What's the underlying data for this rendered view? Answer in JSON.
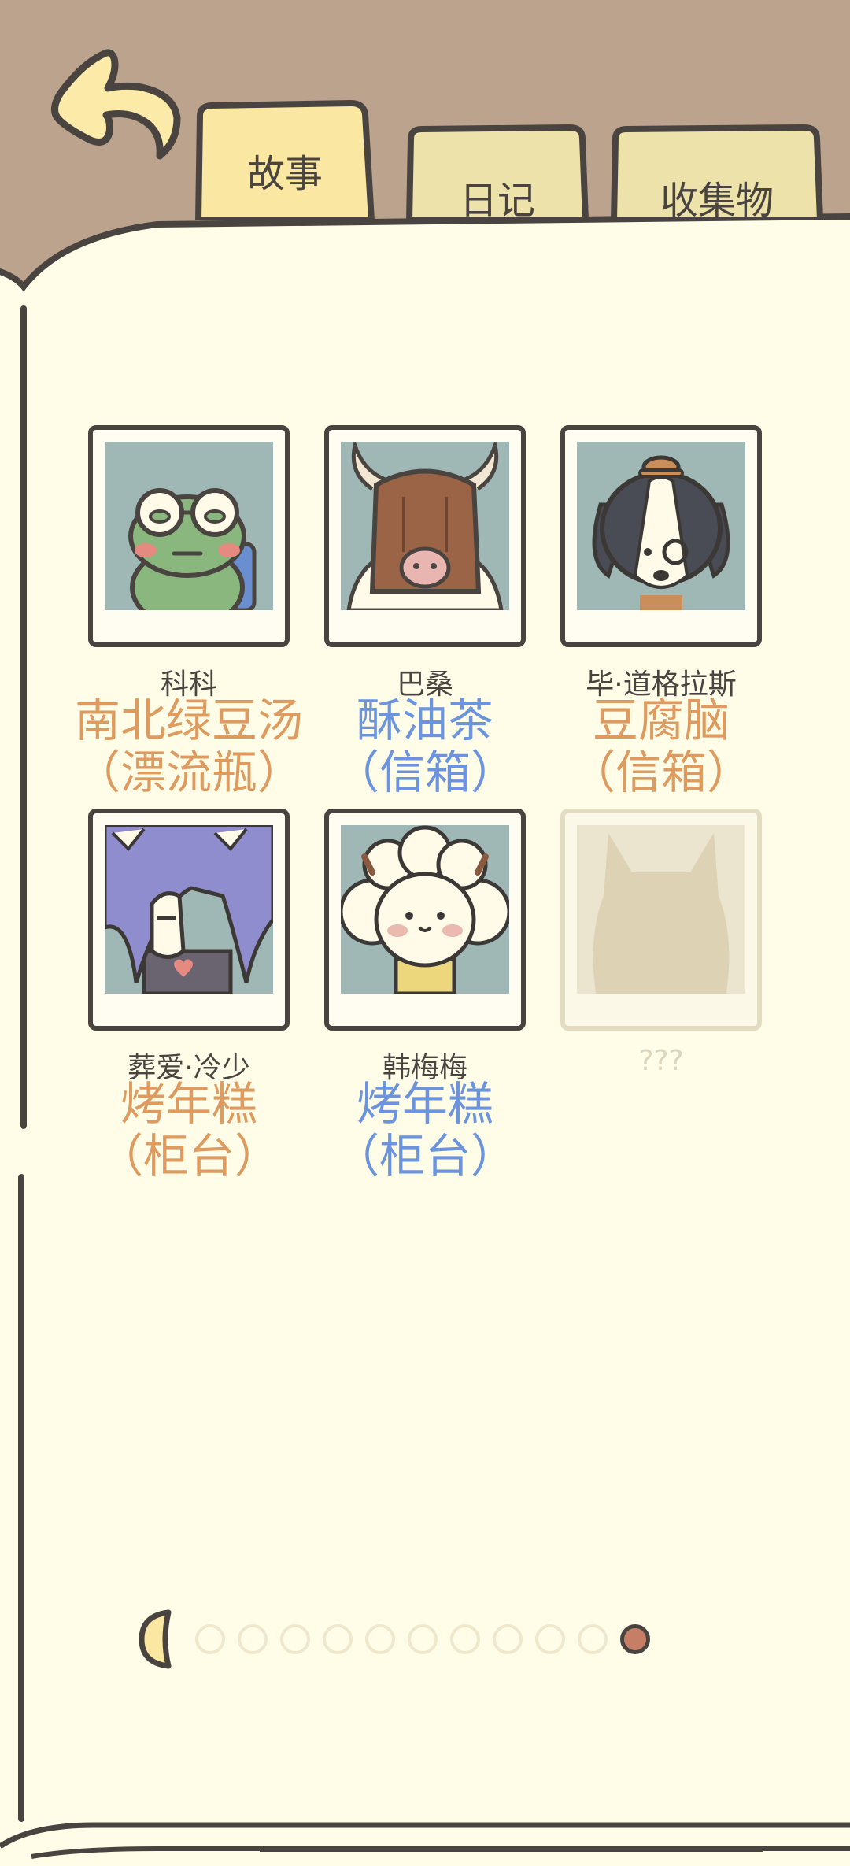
{
  "tabs": [
    {
      "label": "故事",
      "active": true
    },
    {
      "label": "日记",
      "active": false
    },
    {
      "label": "收集物",
      "active": false
    }
  ],
  "characters": [
    {
      "name": "科科",
      "item": "南北绿豆汤",
      "source": "（漂流瓶）",
      "color": "#de9b5f",
      "icon": "frog-portrait-icon"
    },
    {
      "name": "巴桑",
      "item": "酥油茶",
      "source": "（信箱）",
      "color": "#6b93de",
      "icon": "yak-portrait-icon"
    },
    {
      "name": "毕·道格拉斯",
      "item": "豆腐脑",
      "source": "（信箱）",
      "color": "#de9b5f",
      "icon": "dog-portrait-icon"
    },
    {
      "name": "葬爱·冷少",
      "item": "烤年糕",
      "source": "（柜台）",
      "color": "#de9b5f",
      "icon": "purple-hair-portrait-icon"
    },
    {
      "name": "韩梅梅",
      "item": "烤年糕",
      "source": "（柜台）",
      "color": "#6b93de",
      "icon": "sheep-portrait-icon"
    },
    {
      "name": "???",
      "locked": true,
      "icon": "locked-silhouette-icon"
    }
  ],
  "pagination": {
    "total_pages": 11,
    "current_page": 11
  }
}
